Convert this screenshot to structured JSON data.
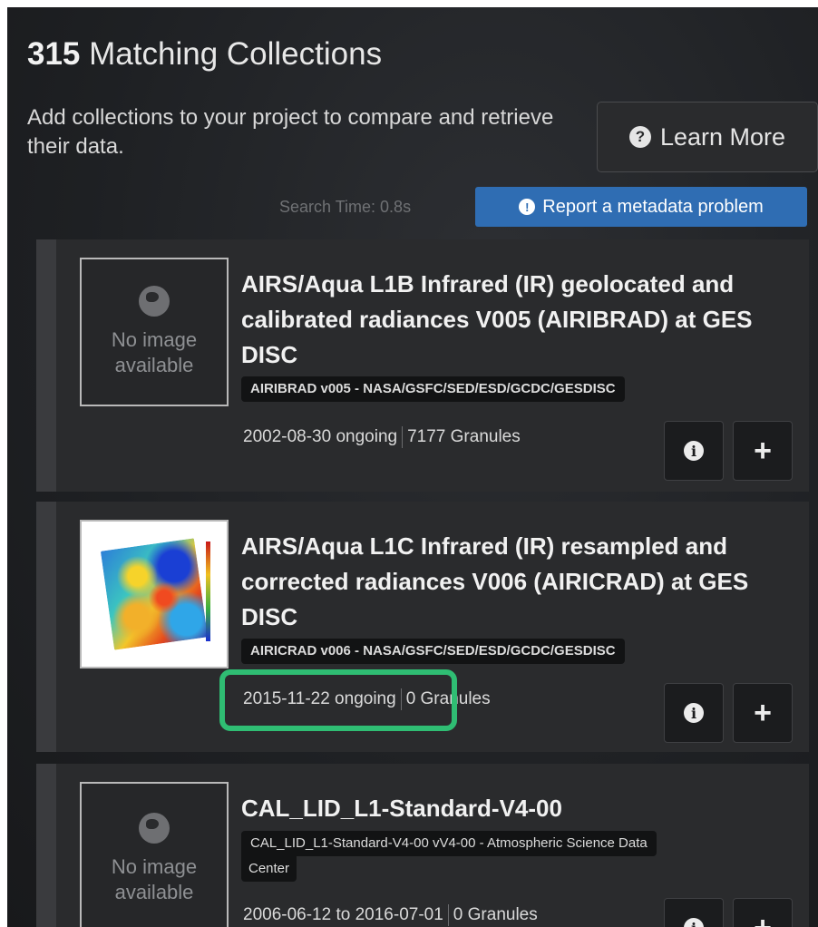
{
  "header": {
    "count": "315",
    "label": "Matching Collections"
  },
  "intro": {
    "text": "Add collections to your project to compare and retrieve their data."
  },
  "learn_more": {
    "label": "Learn More",
    "icon": "question-circle-icon"
  },
  "search_time": "Search Time: 0.8s",
  "report_button": {
    "label": "Report a metadata problem",
    "icon": "exclamation-circle-icon"
  },
  "collections": [
    {
      "thumbnail": {
        "placeholder": "No image available"
      },
      "title": "AIRS/Aqua L1B Infrared (IR) geolocated and calibrated radiances V005 (AIRIBRAD) at GES DISC",
      "tag": "AIRIBRAD v005 - NASA/GSFC/SED/ESD/GCDC/GESDISC",
      "temporal": "2002-08-30 ongoing",
      "granules": "7177 Granules"
    },
    {
      "thumbnail": {
        "placeholder": ""
      },
      "title": "AIRS/Aqua L1C Infrared (IR) resampled and corrected radiances V006 (AIRICRAD) at GES DISC",
      "tag": "AIRICRAD v006 - NASA/GSFC/SED/ESD/GCDC/GESDISC",
      "temporal": "2015-11-22 ongoing",
      "granules": "0 Granules"
    },
    {
      "thumbnail": {
        "placeholder": "No image available"
      },
      "title": "CAL_LID_L1-Standard-V4-00",
      "tag_line1": "CAL_LID_L1-Standard-V4-00 vV4-00 - Atmospheric Science Data",
      "tag_line2": "Center",
      "temporal": "2006-06-12 to 2016-07-01",
      "granules": "0 Granules"
    }
  ],
  "colors": {
    "accent_blue": "#2f6db3",
    "highlight_green": "#2fbd73",
    "panel_bg": "#1e2023",
    "card_bg": "#2a2b2d"
  }
}
